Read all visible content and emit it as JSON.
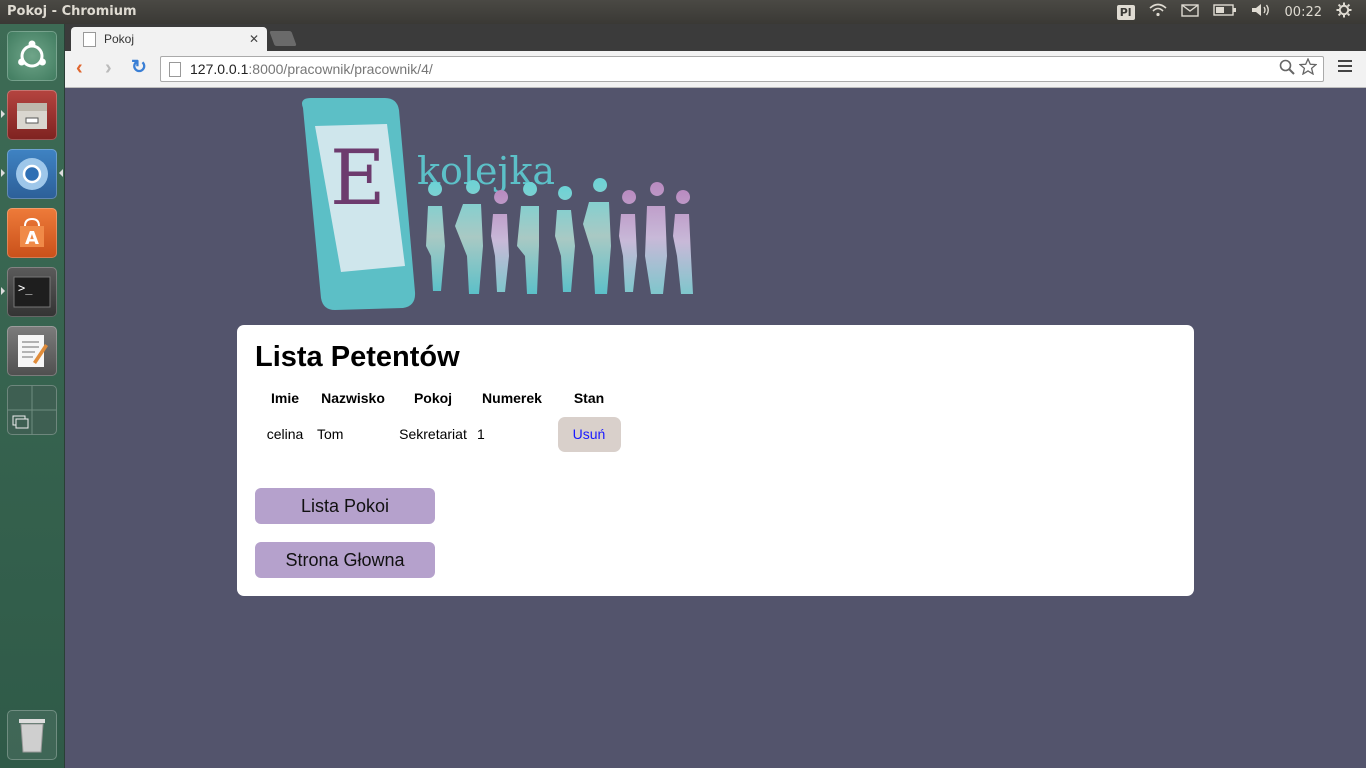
{
  "system": {
    "window_title": "Pokoj - Chromium",
    "keyboard_layout": "Pl",
    "clock": "00:22"
  },
  "browser": {
    "tab_title": "Pokoj",
    "url_host": "127.0.0.1",
    "url_rest": ":8000/pracownik/pracownik/4/"
  },
  "page": {
    "logo_text": "kolejka",
    "logo_letter": "E",
    "heading": "Lista Petentów",
    "table": {
      "headers": [
        "Imie",
        "Nazwisko",
        "Pokoj",
        "Numerek",
        "Stan"
      ],
      "rows": [
        {
          "imie": "celina",
          "nazwisko": "Tom",
          "pokoj": "Sekretariat",
          "numerek": "1",
          "action": "Usuń"
        }
      ]
    },
    "buttons": {
      "lista_pokoi": "Lista Pokoi",
      "strona_glowna": "Strona Głowna"
    }
  },
  "colors": {
    "page_background": "#53546c",
    "button_purple": "#b5a1cc",
    "delete_button": "#d9d0cb",
    "logo_teal": "#5cc0c8",
    "logo_purple": "#6d3b6e"
  },
  "icons": {
    "launcher": [
      "ubuntu-dash-icon",
      "files-icon",
      "chromium-icon",
      "software-center-icon",
      "terminal-icon",
      "text-editor-icon",
      "workspace-switcher-icon",
      "trash-icon"
    ],
    "tray": [
      "keyboard-layout-icon",
      "wifi-icon",
      "mail-icon",
      "battery-icon",
      "volume-icon",
      "settings-gear-icon"
    ]
  }
}
